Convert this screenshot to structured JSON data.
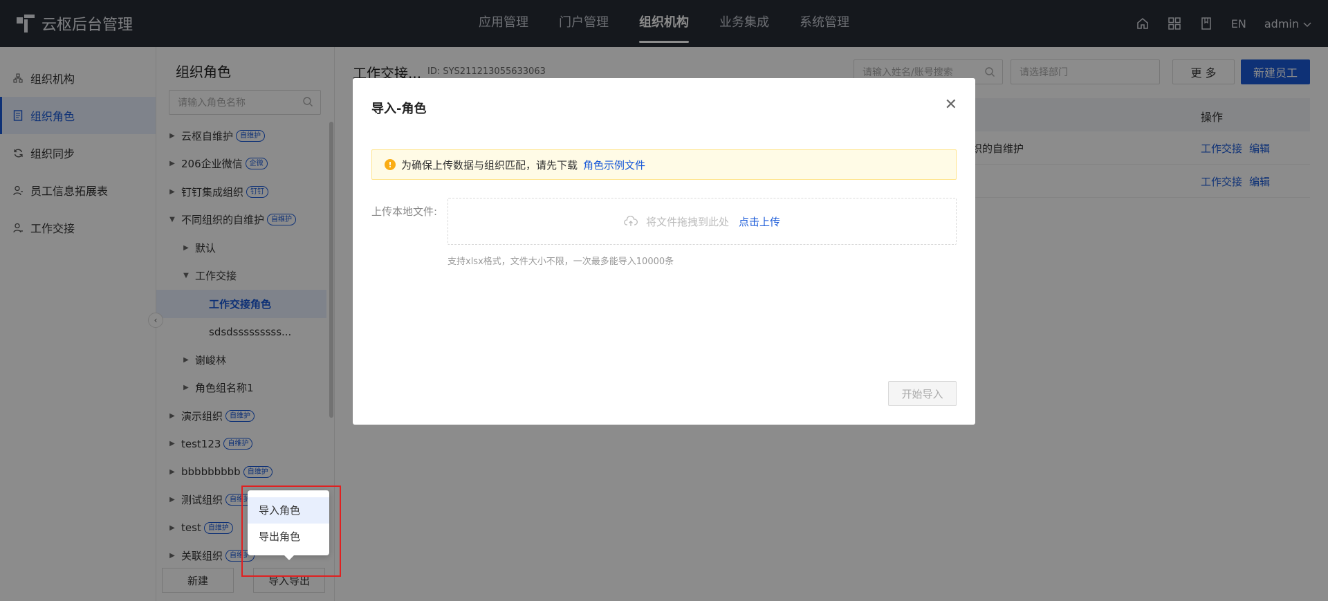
{
  "app": {
    "title": "云枢后台管理"
  },
  "topnav": {
    "items": [
      {
        "label": "应用管理"
      },
      {
        "label": "门户管理"
      },
      {
        "label": "组织机构"
      },
      {
        "label": "业务集成"
      },
      {
        "label": "系统管理"
      }
    ],
    "active_index": 2,
    "lang": "EN",
    "user": "admin"
  },
  "leftnav": {
    "items": [
      {
        "label": "组织机构",
        "icon": "org-tree-icon"
      },
      {
        "label": "组织角色",
        "icon": "role-doc-icon"
      },
      {
        "label": "组织同步",
        "icon": "sync-icon"
      },
      {
        "label": "员工信息拓展表",
        "icon": "user-extend-icon"
      },
      {
        "label": "工作交接",
        "icon": "handover-icon"
      }
    ],
    "active_index": 1
  },
  "tree_panel": {
    "title": "组织角色",
    "search_placeholder": "请输入角色名称",
    "nodes": [
      {
        "label": "云枢自维护",
        "tag": "自维护",
        "level": 0,
        "arrow": "▶"
      },
      {
        "label": "206企业微信",
        "tag": "企微",
        "level": 0,
        "arrow": "▶"
      },
      {
        "label": "钉钉集成组织",
        "tag": "钉钉",
        "level": 0,
        "arrow": "▶"
      },
      {
        "label": "不同组织的自维护",
        "tag": "自维护",
        "level": 0,
        "arrow": "▼"
      },
      {
        "label": "默认",
        "tag": "",
        "level": 1,
        "arrow": "▶"
      },
      {
        "label": "工作交接",
        "tag": "",
        "level": 1,
        "arrow": "▼"
      },
      {
        "label": "工作交接角色",
        "tag": "",
        "level": 2,
        "arrow": "",
        "selected": true
      },
      {
        "label": "sdsdsssssssss...",
        "tag": "",
        "level": 2,
        "arrow": ""
      },
      {
        "label": "谢峻林",
        "tag": "",
        "level": 1,
        "arrow": "▶"
      },
      {
        "label": "角色组名称1",
        "tag": "",
        "level": 1,
        "arrow": "▶"
      },
      {
        "label": "演示组织",
        "tag": "自维护",
        "level": 0,
        "arrow": "▶"
      },
      {
        "label": "test123",
        "tag": "自维护",
        "level": 0,
        "arrow": "▶"
      },
      {
        "label": "bbbbbbbbb",
        "tag": "自维护",
        "level": 0,
        "arrow": "▶"
      },
      {
        "label": "测试组织",
        "tag": "自维护",
        "level": 0,
        "arrow": "▶"
      },
      {
        "label": "test",
        "tag": "自维护",
        "level": 0,
        "arrow": "▶"
      },
      {
        "label": "关联组织",
        "tag": "自维护",
        "level": 0,
        "arrow": "▶"
      }
    ],
    "new_button": "新建",
    "import_export_button": "导入导出"
  },
  "main": {
    "title": "工作交接...",
    "id_text": "ID: SYS211213055633063",
    "search_placeholder": "请输入姓名/账号搜索",
    "dept_placeholder": "请选择部门",
    "more_button": "更 多",
    "new_employee_button": "新建员工",
    "table": {
      "op_header": "操作",
      "rows": [
        {
          "col": "组织的自维护",
          "link1": "工作交接",
          "link2": "编辑"
        },
        {
          "col": "",
          "link1": "工作交接",
          "link2": "编辑"
        }
      ]
    }
  },
  "modal": {
    "title": "导入-角色",
    "alert_text": "为确保上传数据与组织匹配，请先下载",
    "alert_link": "角色示例文件",
    "upload_label": "上传本地文件:",
    "drop_text": "将文件拖拽到此处",
    "upload_link": "点击上传",
    "hint": "支持xlsx格式，文件大小不限，一次最多能导入10000条",
    "start_button": "开始导入"
  },
  "popup_menu": {
    "items": [
      {
        "label": "导入角色"
      },
      {
        "label": "导出角色"
      }
    ]
  },
  "colors": {
    "accent": "#1a5ad8",
    "topbar": "#272c36",
    "highlight_box": "#e02020"
  }
}
